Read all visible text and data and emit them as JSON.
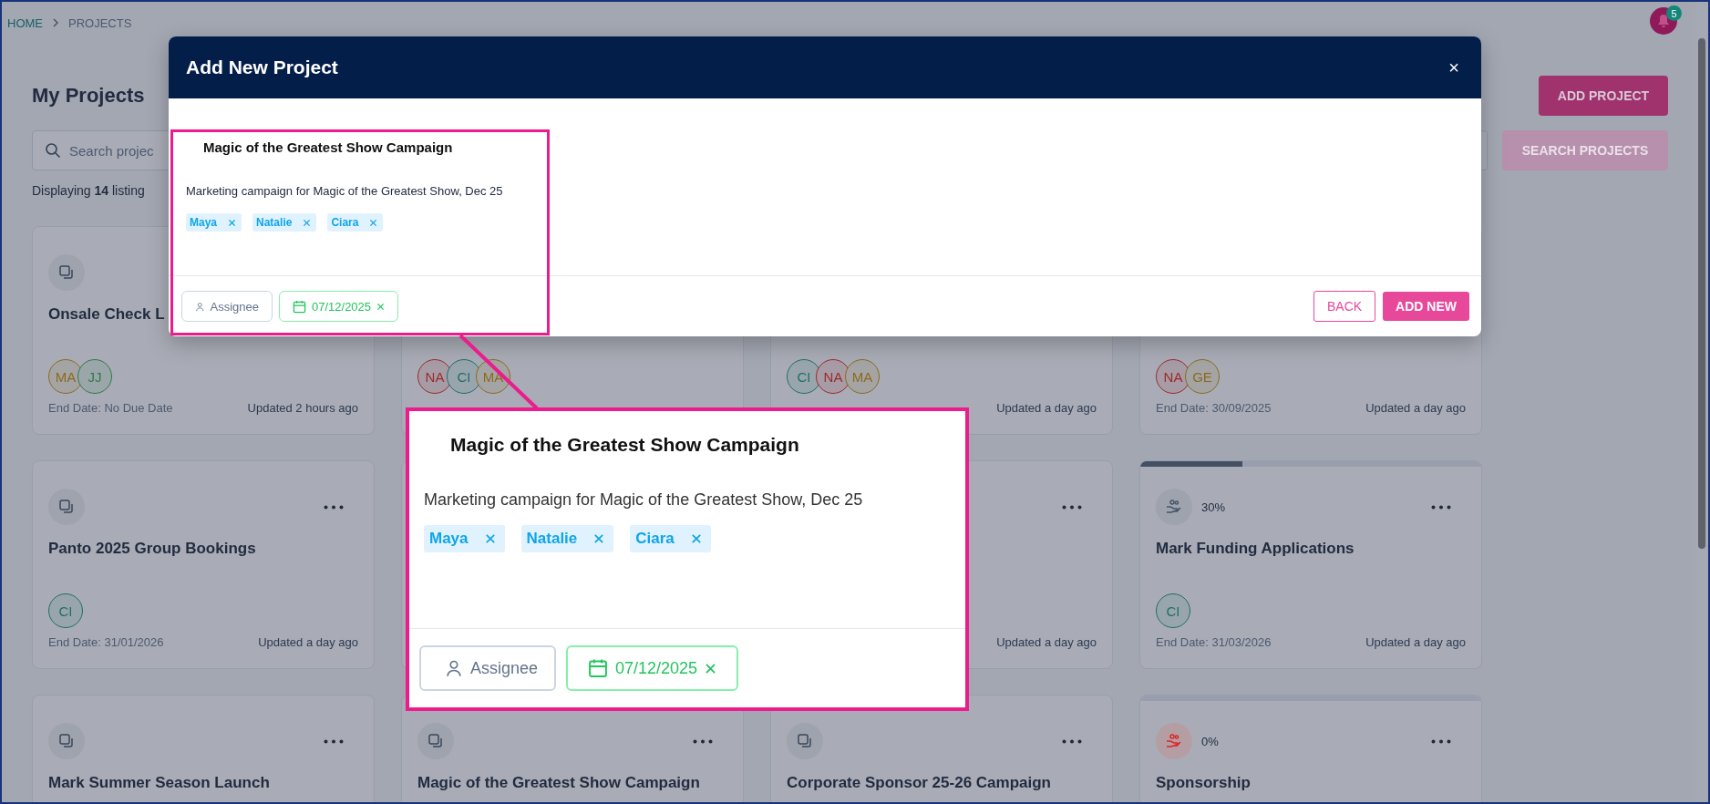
{
  "breadcrumb": [
    {
      "label": "HOME",
      "selected": false
    },
    {
      "label": "PROJECTS",
      "selected": true
    }
  ],
  "notifications": {
    "count": "5"
  },
  "page": {
    "title": "My Projects",
    "add_button": "ADD PROJECT",
    "search": {
      "placeholder": "Search projec"
    },
    "search_button": {
      "label": "SEARCH PROJECTS",
      "disabled": true
    },
    "summary": "Displaying **14** listing"
  },
  "cards": [
    {
      "kind": "task",
      "title": "Onsale Check L",
      "assignees": [
        {
          "initials": "MA",
          "color": "#8a6a1e"
        },
        {
          "initials": "JJ",
          "color": "#2f7a4a"
        }
      ],
      "end_date": "End Date: No Due Date",
      "updated": "Updated 2 hours ago"
    },
    {
      "assignees": [
        {
          "initials": "NA",
          "color": "#9b2a2a"
        },
        {
          "initials": "CI",
          "color": "#1f6f66"
        },
        {
          "initials": "MA",
          "color": "#8a6a1e"
        }
      ]
    },
    {
      "assignees": [
        {
          "initials": "CI",
          "color": "#1f6f66"
        },
        {
          "initials": "NA",
          "color": "#9b2a2a"
        },
        {
          "initials": "MA",
          "color": "#8a6a1e"
        }
      ],
      "updated": "Updated a day ago"
    },
    {
      "assignees": [
        {
          "initials": "NA",
          "color": "#9b2a2a"
        },
        {
          "initials": "GE",
          "color": "#8a6a1e"
        }
      ],
      "end_date": "End Date: 30/09/2025",
      "updated": "Updated a day ago"
    },
    {
      "kind": "task",
      "title": "Panto 2025 Group Bookings",
      "menu": true,
      "assignees": [
        {
          "initials": "CI",
          "color": "#1f6f66"
        }
      ],
      "end_date": "End Date: 31/01/2026",
      "updated": "Updated a day ago"
    },
    {
      "menu": true,
      "updated": "Updated a day ago"
    },
    {
      "kind": "funding",
      "alert": false,
      "progress": {
        "level": 0.3,
        "reading": "30%"
      },
      "title": "Mark Funding Applications",
      "menu": true,
      "assignees": [
        {
          "initials": "CI",
          "color": "#1f6f66"
        }
      ],
      "end_date": "End Date: 31/03/2026",
      "updated": "Updated a day ago"
    },
    {
      "kind": "task",
      "title": "Mark Summer Season Launch",
      "menu": true
    },
    {
      "kind": "task",
      "title": "Magic of the Greatest Show Campaign",
      "menu": true
    },
    {
      "kind": "task",
      "title": "Corporate Sponsor 25-26 Campaign",
      "menu": true
    },
    {
      "kind": "funding",
      "alert": true,
      "progress": {
        "level": 0,
        "reading": "0%"
      },
      "title": "Sponsorship",
      "menu": true
    }
  ],
  "modal": {
    "title": "Add New Project",
    "close": "×",
    "project": {
      "title": "Magic of the Greatest Show Campaign",
      "description": "Marketing campaign for Magic of the Greatest Show, Dec 25",
      "tags": [
        "Maya",
        "Natalie",
        "Ciara"
      ],
      "assignee": {
        "placeholder": "Assignee"
      },
      "date": "07/12/2025"
    },
    "buttons": [
      "BACK",
      "ADD NEW"
    ]
  },
  "callout": {
    "title": "Magic of the Greatest Show Campaign",
    "description": "Marketing campaign for Magic of the Greatest Show, Dec 25",
    "tags": [
      "Maya",
      "Natalie",
      "Ciara"
    ],
    "assignee": {
      "placeholder": "Assignee"
    },
    "date": "07/12/2025"
  }
}
